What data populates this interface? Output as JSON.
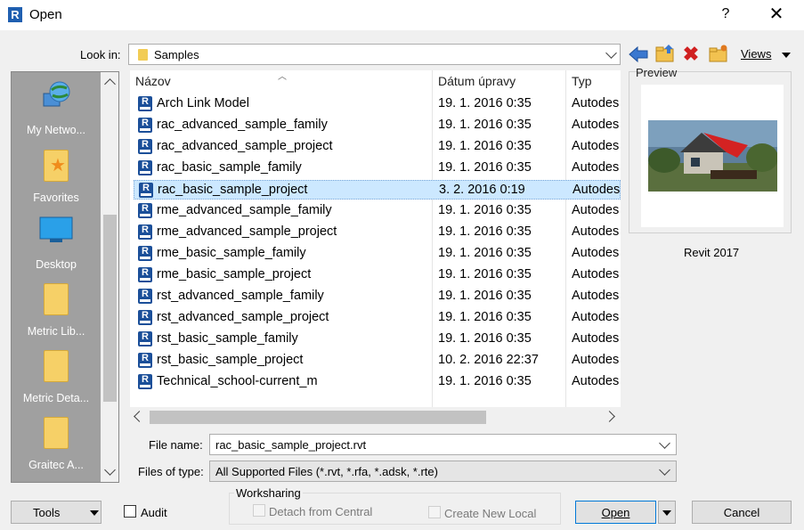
{
  "window": {
    "title": "Open",
    "app_icon_letter": "R",
    "help_label": "?",
    "close_label": "✕"
  },
  "look_in": {
    "label": "Look in:",
    "value": "Samples"
  },
  "toolbar": {
    "views_label": "Views"
  },
  "places": [
    {
      "label": "My Netwo...",
      "icon": "network-globe-icon"
    },
    {
      "label": "Favorites",
      "icon": "favorites-star-folder-icon"
    },
    {
      "label": "Desktop",
      "icon": "desktop-monitor-icon"
    },
    {
      "label": "Metric Lib...",
      "icon": "folder-icon"
    },
    {
      "label": "Metric Deta...",
      "icon": "folder-icon"
    },
    {
      "label": "Graitec A...",
      "icon": "folder-icon"
    }
  ],
  "file_list": {
    "columns": [
      "Názov",
      "Dátum úpravy",
      "Typ"
    ],
    "rows": [
      {
        "name": "Arch Link Model",
        "date": "19. 1. 2016 0:35",
        "type": "Autodes"
      },
      {
        "name": "rac_advanced_sample_family",
        "date": "19. 1. 2016 0:35",
        "type": "Autodes"
      },
      {
        "name": "rac_advanced_sample_project",
        "date": "19. 1. 2016 0:35",
        "type": "Autodes"
      },
      {
        "name": "rac_basic_sample_family",
        "date": "19. 1. 2016 0:35",
        "type": "Autodes"
      },
      {
        "name": "rac_basic_sample_project",
        "date": "3. 2. 2016 0:19",
        "type": "Autodes",
        "selected": true
      },
      {
        "name": "rme_advanced_sample_family",
        "date": "19. 1. 2016 0:35",
        "type": "Autodes"
      },
      {
        "name": "rme_advanced_sample_project",
        "date": "19. 1. 2016 0:35",
        "type": "Autodes"
      },
      {
        "name": "rme_basic_sample_family",
        "date": "19. 1. 2016 0:35",
        "type": "Autodes"
      },
      {
        "name": "rme_basic_sample_project",
        "date": "19. 1. 2016 0:35",
        "type": "Autodes"
      },
      {
        "name": "rst_advanced_sample_family",
        "date": "19. 1. 2016 0:35",
        "type": "Autodes"
      },
      {
        "name": "rst_advanced_sample_project",
        "date": "19. 1. 2016 0:35",
        "type": "Autodes"
      },
      {
        "name": "rst_basic_sample_family",
        "date": "19. 1. 2016 0:35",
        "type": "Autodes"
      },
      {
        "name": "rst_basic_sample_project",
        "date": "10. 2. 2016 22:37",
        "type": "Autodes"
      },
      {
        "name": "Technical_school-current_m",
        "date": "19. 1. 2016 0:35",
        "type": "Autodes"
      }
    ]
  },
  "preview": {
    "label": "Preview",
    "version": "Revit 2017"
  },
  "file_name": {
    "label": "File name:",
    "value": "rac_basic_sample_project.rvt"
  },
  "file_type": {
    "label": "Files of type:",
    "value": "All Supported Files  (*.rvt, *.rfa, *.adsk, *.rte)"
  },
  "tools": {
    "label": "Tools"
  },
  "audit": {
    "label": "Audit",
    "checked": false
  },
  "worksharing": {
    "title": "Worksharing",
    "detach_label": "Detach from Central",
    "create_local_label": "Create New Local"
  },
  "buttons": {
    "open": "Open",
    "cancel": "Cancel"
  },
  "colors": {
    "selection": "#cce8ff",
    "places_bg": "#a0a0a0",
    "rvt_icon": "#1b4f99",
    "accent": "#0078d7"
  }
}
